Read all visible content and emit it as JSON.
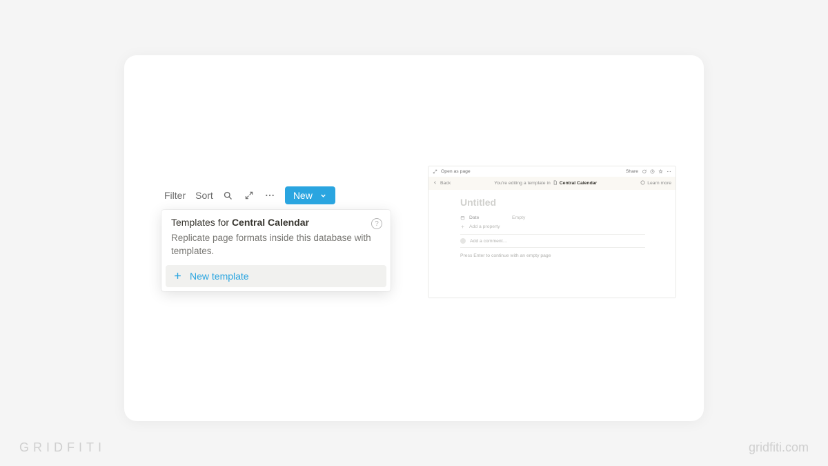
{
  "brand": {
    "left_text": "GRIDFITI",
    "right_text": "gridfiti.com"
  },
  "toolbar": {
    "filter": "Filter",
    "sort": "Sort",
    "new": "New"
  },
  "popup": {
    "title_prefix": "Templates for ",
    "title_bold": "Central Calendar",
    "description": "Replicate page formats inside this database with templates.",
    "new_template": "New template"
  },
  "preview": {
    "open_as_page": "Open as page",
    "share": "Share",
    "back": "Back",
    "banner_prefix": "You're editing a template in",
    "banner_db": "Central Calendar",
    "learn_more": "Learn more",
    "title": "Untitled",
    "prop_date_name": "Date",
    "prop_date_value": "Empty",
    "add_property": "Add a property",
    "comment_placeholder": "Add a comment…",
    "empty_hint": "Press Enter to continue with an empty page"
  }
}
